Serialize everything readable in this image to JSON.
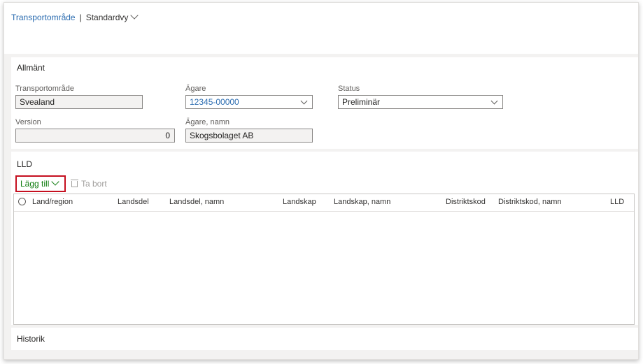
{
  "breadcrumb": {
    "module": "Transportområde",
    "separator": "|",
    "view": "Standardvy"
  },
  "general": {
    "title": "Allmänt",
    "transport_area": {
      "label": "Transportområde",
      "value": "Svealand"
    },
    "owner": {
      "label": "Ägare",
      "value": "12345-00000"
    },
    "status": {
      "label": "Status",
      "value": "Preliminär"
    },
    "version": {
      "label": "Version",
      "value": "0"
    },
    "owner_name": {
      "label": "Ägare, namn",
      "value": "Skogsbolaget AB"
    }
  },
  "lld": {
    "title": "LLD",
    "toolbar": {
      "add_label": "Lägg till",
      "remove_label": "Ta bort"
    },
    "columns": [
      "Land/region",
      "Landsdel",
      "Landsdel, namn",
      "Landskap",
      "Landskap, namn",
      "Distriktskod",
      "Distriktskod, namn",
      "LLD"
    ],
    "rows": []
  },
  "history": {
    "title": "Historik"
  },
  "icons": {
    "chevron": "chevron-down-icon",
    "trash": "trash-icon",
    "radio": "radio-circle-icon"
  },
  "colors": {
    "link": "#2b6cb0",
    "highlight": "#c50f1f",
    "add": "#107c10"
  }
}
